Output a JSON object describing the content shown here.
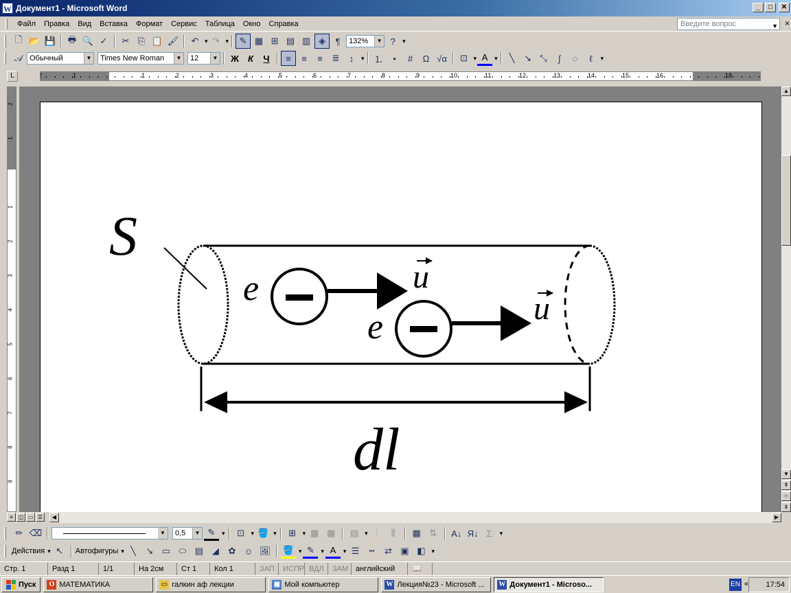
{
  "window": {
    "title": "Документ1 - Microsoft Word",
    "app_icon": "W"
  },
  "menu": {
    "items": [
      "Файл",
      "Правка",
      "Вид",
      "Вставка",
      "Формат",
      "Сервис",
      "Таблица",
      "Окно",
      "Справка"
    ],
    "ask_placeholder": "Введите вопрос"
  },
  "standard_toolbar": {
    "zoom": "132%"
  },
  "formatting_toolbar": {
    "style": "Обычный",
    "font": "Times New Roman",
    "size": "12",
    "bold": "Ж",
    "italic": "К",
    "underline": "Ч"
  },
  "ruler": {
    "h_numbers": [
      "2",
      "1",
      "1",
      "2",
      "3",
      "4",
      "5",
      "6",
      "7",
      "8",
      "9",
      "10",
      "11",
      "12",
      "13",
      "14",
      "15",
      "16",
      "18"
    ],
    "v_numbers": [
      "2",
      "1",
      "1",
      "2",
      "3",
      "4",
      "5",
      "6",
      "7",
      "8",
      "9"
    ]
  },
  "figure": {
    "area_label": "S",
    "charge_label_1": "e",
    "charge_label_2": "e",
    "velocity_label_1": "u",
    "velocity_label_2": "u",
    "charge_sign": "−",
    "length_label": "dl"
  },
  "drawing_toolbar": {
    "line_width": "0,5",
    "actions": "Действия",
    "autoshapes": "Автофигуры"
  },
  "status": {
    "page": "Стр. 1",
    "section": "Разд 1",
    "pages": "1/1",
    "at": "На 2см",
    "line": "Ст 1",
    "col": "Кол 1",
    "rec": "ЗАП",
    "trk": "ИСПР",
    "ext": "ВДЛ",
    "ovr": "ЗАМ",
    "language": "английский"
  },
  "taskbar": {
    "start": "Пуск",
    "tasks": [
      "МАТЕМАТИКА",
      "галкин аф лекции",
      "Мой компьютер",
      "Лекция№23 - Microsoft ...",
      "Документ1 - Microso..."
    ],
    "lang": "EN",
    "clock": "17:54"
  }
}
